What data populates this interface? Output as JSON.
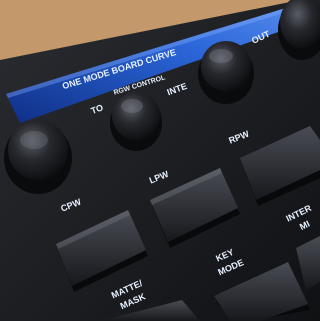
{
  "display": {
    "menu_line": "ONE MODE BOARD CURVE",
    "sub_line": "RGW CONTROL"
  },
  "knob_labels": {
    "k2": "TO",
    "k3": "INTE",
    "k4": "OUT"
  },
  "button_labels": {
    "cpw": "CPW",
    "lpw": "LPW",
    "rpw": "RPW",
    "key_mode_line1": "KEY",
    "key_mode_line2": "MODE",
    "matte_mask_line1": "MATTE/",
    "matte_mask_line2": "MASK",
    "right_line1": "INTER",
    "right_line2": "MI"
  },
  "colors": {
    "backdrop": "#b88a5c",
    "panel": "#1c1d22",
    "screen": "#1f57c9",
    "label": "#e6f0ff"
  }
}
